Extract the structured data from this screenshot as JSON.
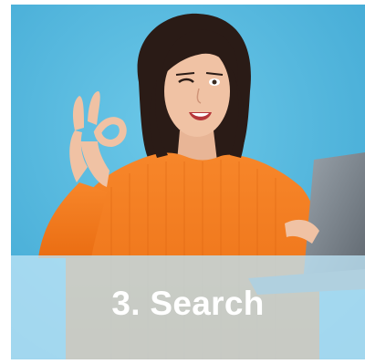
{
  "card": {
    "step_title": "3. Search",
    "image_subject": "woman-ok-gesture-laptop-photo"
  },
  "colors": {
    "background": "#55b8dd",
    "sweater": "#f47c1c",
    "caption_band": "#bee4f6",
    "caption_text": "#ffffff"
  }
}
